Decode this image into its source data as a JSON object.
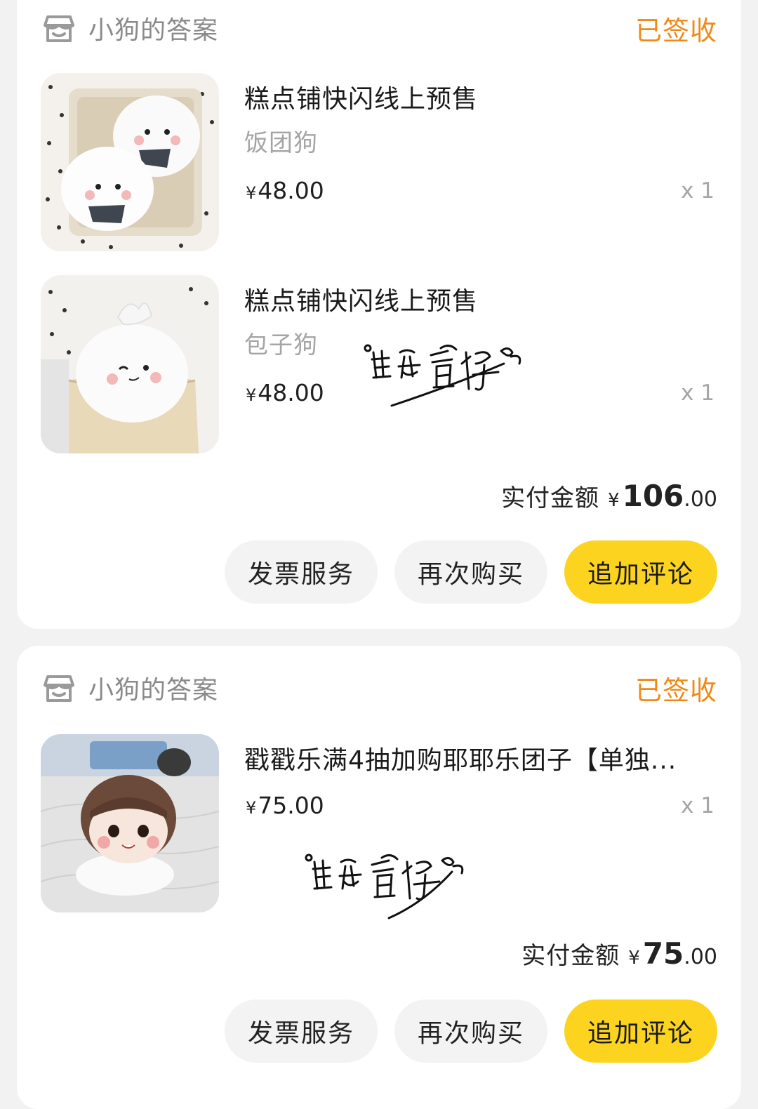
{
  "orders": [
    {
      "shop_name": "小狗的答案",
      "status": "已签收",
      "items": [
        {
          "title": "糕点铺快闪线上预售",
          "variant": "饭团狗",
          "price_symbol": "¥",
          "price": "48.00",
          "qty": "x 1",
          "thumb_icon": "rice-ball-plush-photo"
        },
        {
          "title": "糕点铺快闪线上预售",
          "variant": "包子狗",
          "price_symbol": "¥",
          "price": "48.00",
          "qty": "x 1",
          "thumb_icon": "steamed-bun-plush-photo"
        }
      ],
      "total_label": "实付金额",
      "total_symbol": "¥",
      "total_int": "106",
      "total_dec": ".00",
      "buttons": {
        "invoice": "发票服务",
        "rebuy": "再次购买",
        "review": "追加评论"
      }
    },
    {
      "shop_name": "小狗的答案",
      "status": "已签收",
      "items": [
        {
          "title": "戳戳乐满4抽加购耶耶乐团子【单独...",
          "price_symbol": "¥",
          "price": "75.00",
          "qty": "x 1",
          "thumb_icon": "doll-plush-photo"
        }
      ],
      "total_label": "实付金额",
      "total_symbol": "¥",
      "total_int": "75",
      "total_dec": ".00",
      "buttons": {
        "invoice": "发票服务",
        "rebuy": "再次购买",
        "review": "追加评论"
      }
    }
  ],
  "watermark_text": "酱香鱼仔",
  "colors": {
    "status": "#ef8a1a",
    "primary_button": "#fcd420",
    "page_bg": "#f2f2f2"
  }
}
